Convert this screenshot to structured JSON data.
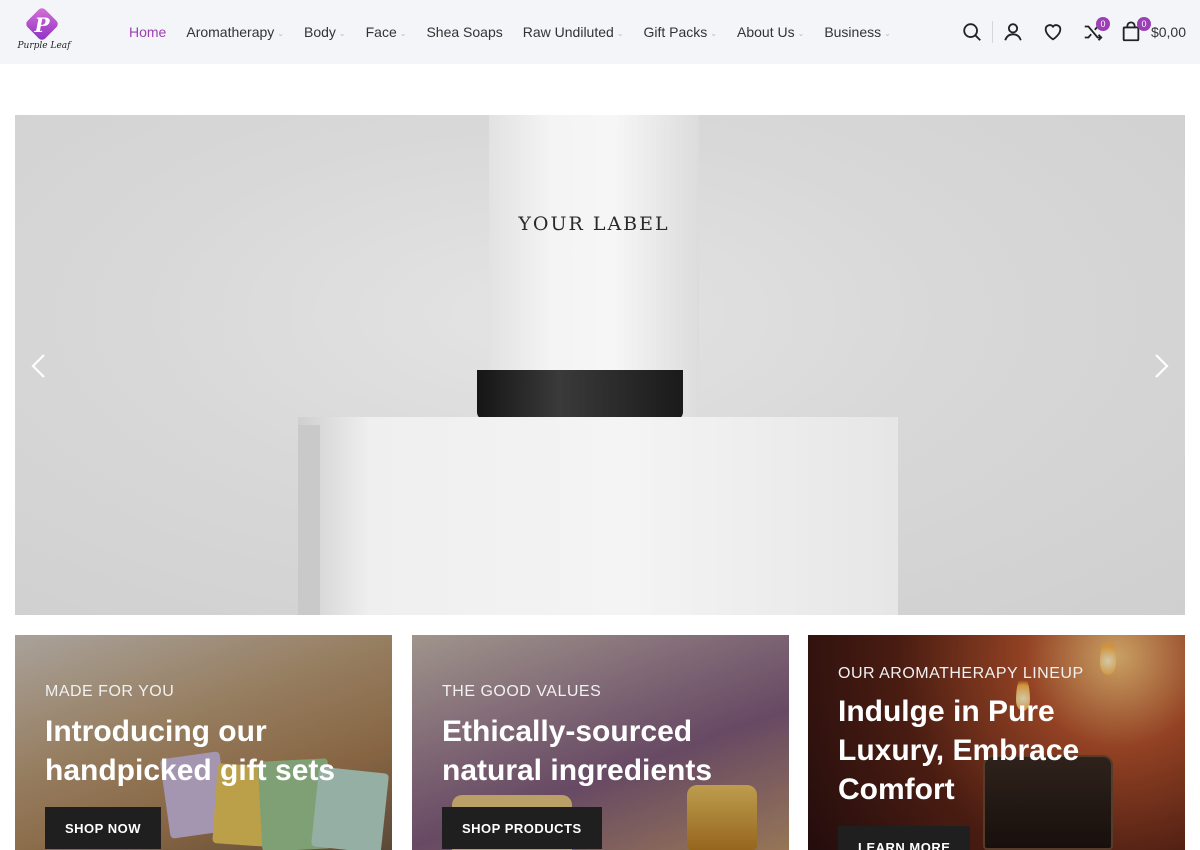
{
  "brand": {
    "logo_letter": "P",
    "logo_text": "Purple Leaf"
  },
  "nav": [
    {
      "label": "Home",
      "active": true,
      "has_dropdown": false
    },
    {
      "label": "Aromatherapy",
      "active": false,
      "has_dropdown": true
    },
    {
      "label": "Body",
      "active": false,
      "has_dropdown": true
    },
    {
      "label": "Face",
      "active": false,
      "has_dropdown": true
    },
    {
      "label": "Shea Soaps",
      "active": false,
      "has_dropdown": false
    },
    {
      "label": "Raw Undiluted",
      "active": false,
      "has_dropdown": true
    },
    {
      "label": "Gift Packs",
      "active": false,
      "has_dropdown": true
    },
    {
      "label": "About Us",
      "active": false,
      "has_dropdown": true
    },
    {
      "label": "Business",
      "active": false,
      "has_dropdown": true
    }
  ],
  "tools": {
    "compare_count": "0",
    "cart_count": "0",
    "cart_total": "$0,00"
  },
  "hero": {
    "bottle_label": "YOUR LABEL"
  },
  "cards": [
    {
      "subtitle": "MADE FOR YOU",
      "title": "Introducing our handpicked gift sets",
      "button": "SHOP NOW"
    },
    {
      "subtitle": "THE GOOD VALUES",
      "title": "Ethically-sourced natural ingredients",
      "button": "SHOP PRODUCTS"
    },
    {
      "subtitle": "OUR AROMATHERAPY LINEUP",
      "title": "Indulge in Pure Luxury, Embrace Comfort",
      "button": "LEARN MORE"
    }
  ],
  "colors": {
    "accent": "#9b3fb5",
    "header_bg": "#f4f5f9",
    "button_bg": "#1f1f1f"
  }
}
